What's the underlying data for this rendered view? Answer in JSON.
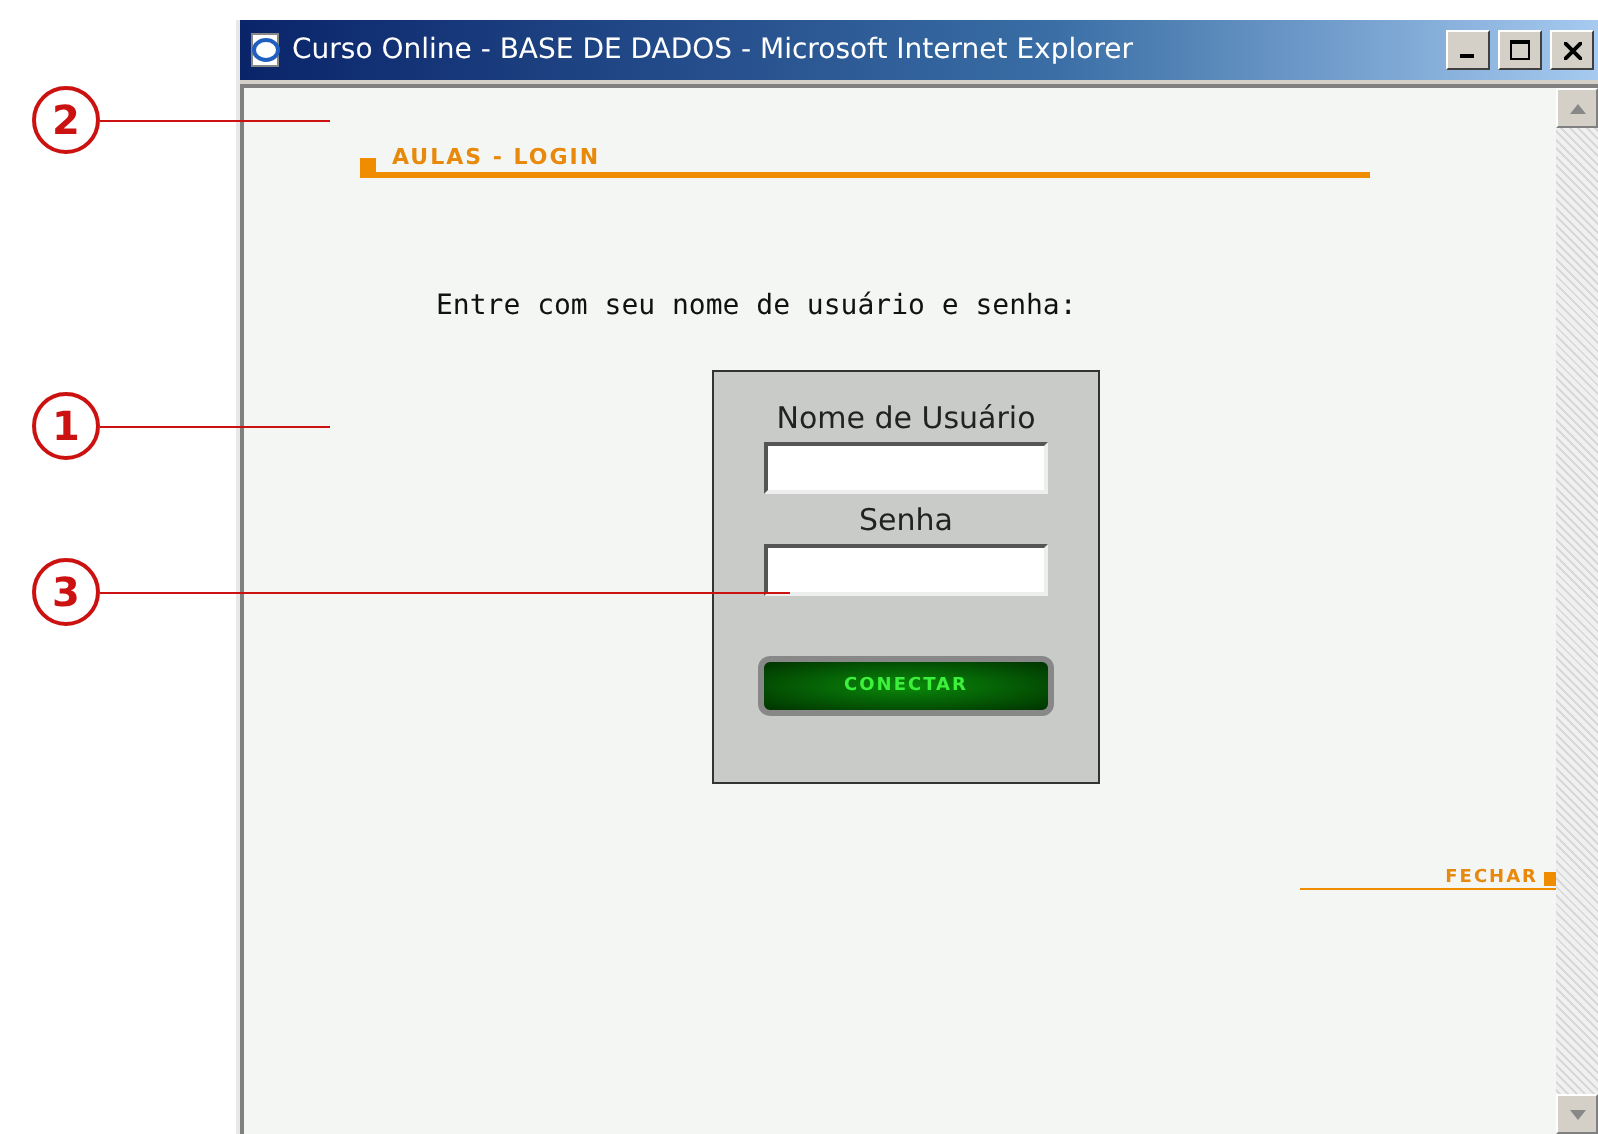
{
  "callouts": [
    {
      "number": "2"
    },
    {
      "number": "1"
    },
    {
      "number": "3"
    }
  ],
  "window": {
    "title": "Curso Online - BASE DE DADOS - Microsoft Internet Explorer"
  },
  "heading": "AULAS - LOGIN",
  "instruction": "Entre com seu nome de usuário e senha:",
  "login": {
    "username_label": "Nome de Usuário",
    "password_label": "Senha",
    "button": "CONECTAR"
  },
  "close_link": "FECHAR"
}
